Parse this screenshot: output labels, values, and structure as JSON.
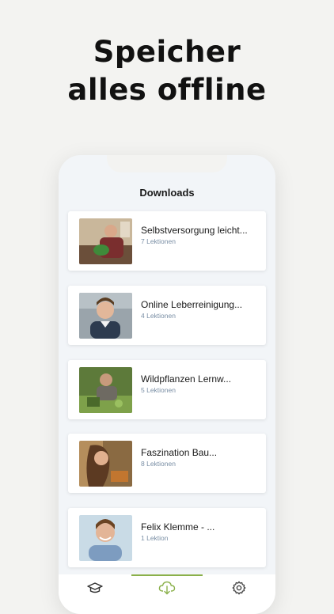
{
  "headline": {
    "line1": "Speicher",
    "line2": "alles offline"
  },
  "screen": {
    "title": "Downloads"
  },
  "downloads": [
    {
      "title": "Selbstversorgung leicht...",
      "subtitle": "7 Lektionen"
    },
    {
      "title": "Online Leberreinigung...",
      "subtitle": "4 Lektionen"
    },
    {
      "title": "Wildpflanzen Lernw...",
      "subtitle": "5 Lektionen"
    },
    {
      "title": "Faszination Bau...",
      "subtitle": "8 Lektionen"
    },
    {
      "title": "Felix Klemme - ...",
      "subtitle": "1 Lektion"
    }
  ],
  "tabs": [
    {
      "icon": "graduation-cap-icon",
      "active": false
    },
    {
      "icon": "cloud-download-icon",
      "active": true
    },
    {
      "icon": "gear-icon",
      "active": false
    }
  ],
  "colors": {
    "accent": "#8ab04a",
    "subtitle": "#7a8fa5",
    "background": "#f3f3f1"
  }
}
